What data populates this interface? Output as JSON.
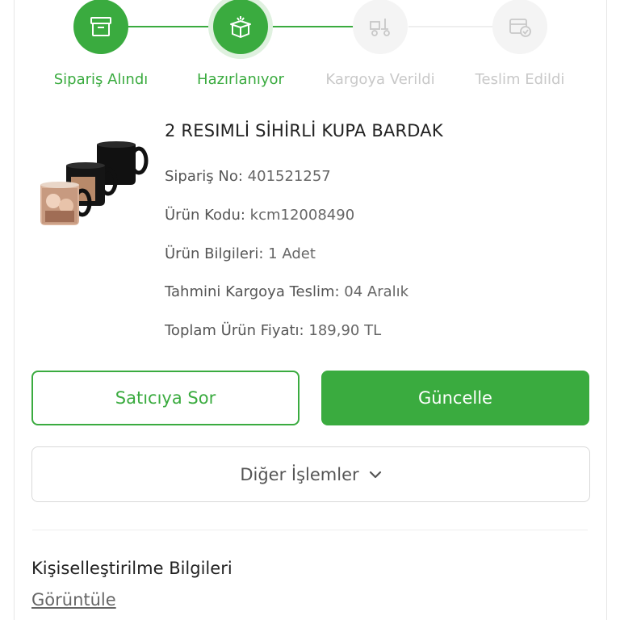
{
  "stepper": {
    "steps": [
      {
        "label": "Sipariş Alındı",
        "state": "done",
        "icon": "box-icon"
      },
      {
        "label": "Hazırlanıyor",
        "state": "active",
        "icon": "open-box-icon"
      },
      {
        "label": "Kargoya Verildi",
        "state": "pending",
        "icon": "cart-icon"
      },
      {
        "label": "Teslim Edildi",
        "state": "pending",
        "icon": "delivered-box-icon"
      }
    ]
  },
  "product": {
    "title": "2 RESIMLİ SİHİRLİ KUPA BARDAK",
    "order_no_key": "Sipariş No:",
    "order_no": "401521257",
    "product_code_key": "Ürün Kodu:",
    "product_code": "kcm12008490",
    "product_info_key": "Ürün Bilgileri:",
    "product_info": "1 Adet",
    "shipping_key": "Tahmini Kargoya Teslim:",
    "shipping": "04 Aralık",
    "total_key": "Toplam Ürün Fiyatı:",
    "total": "189,90 TL"
  },
  "actions": {
    "ask_seller": "Satıcıya Sor",
    "update": "Güncelle",
    "more": "Diğer İşlemler"
  },
  "personalization": {
    "title": "Kişiselleştirilme Bilgileri",
    "view_link": "Görüntüle"
  },
  "colors": {
    "accent": "#3aab3f",
    "pending": "#c8c8c8"
  }
}
